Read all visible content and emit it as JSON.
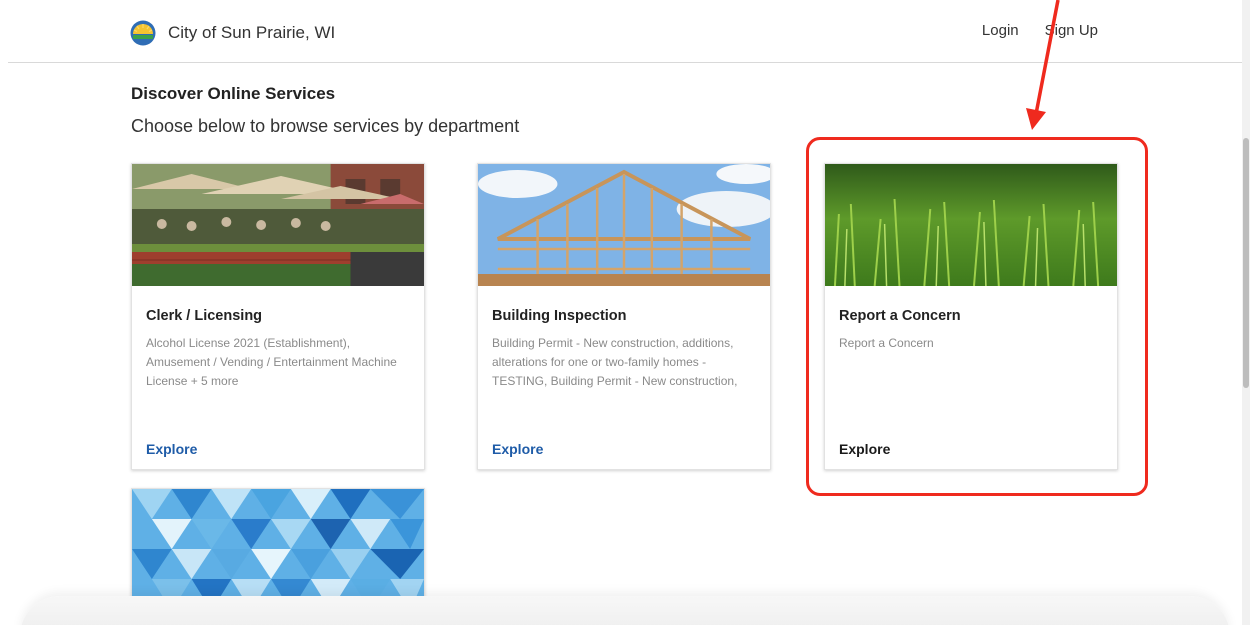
{
  "header": {
    "site_name": "City of Sun Prairie, WI",
    "logo_icon": "sun-prairie-logo",
    "login_label": "Login",
    "signup_label": "Sign Up"
  },
  "main": {
    "heading": "Discover Online Services",
    "subheading": "Choose below to browse services by department"
  },
  "cards": [
    {
      "title": "Clerk / Licensing",
      "description": "Alcohol License 2021 (Establishment), Amusement / Vending / Entertainment Machine License + 5 more",
      "explore": "Explore",
      "image": "outdoor-patio-dining-photo"
    },
    {
      "title": "Building Inspection",
      "description": "Building Permit - New construction, additions, alterations for one or two-family homes - TESTING, Building Permit - New construction,",
      "explore": "Explore",
      "image": "wood-house-framing-photo"
    },
    {
      "title": "Report a Concern",
      "description": "Report a Concern",
      "explore": "Explore",
      "image": "green-grass-photo"
    },
    {
      "image": "blue-triangle-pattern"
    }
  ],
  "colors": {
    "link_blue": "#1f5ca8",
    "highlight_red": "#ef2a1e"
  }
}
